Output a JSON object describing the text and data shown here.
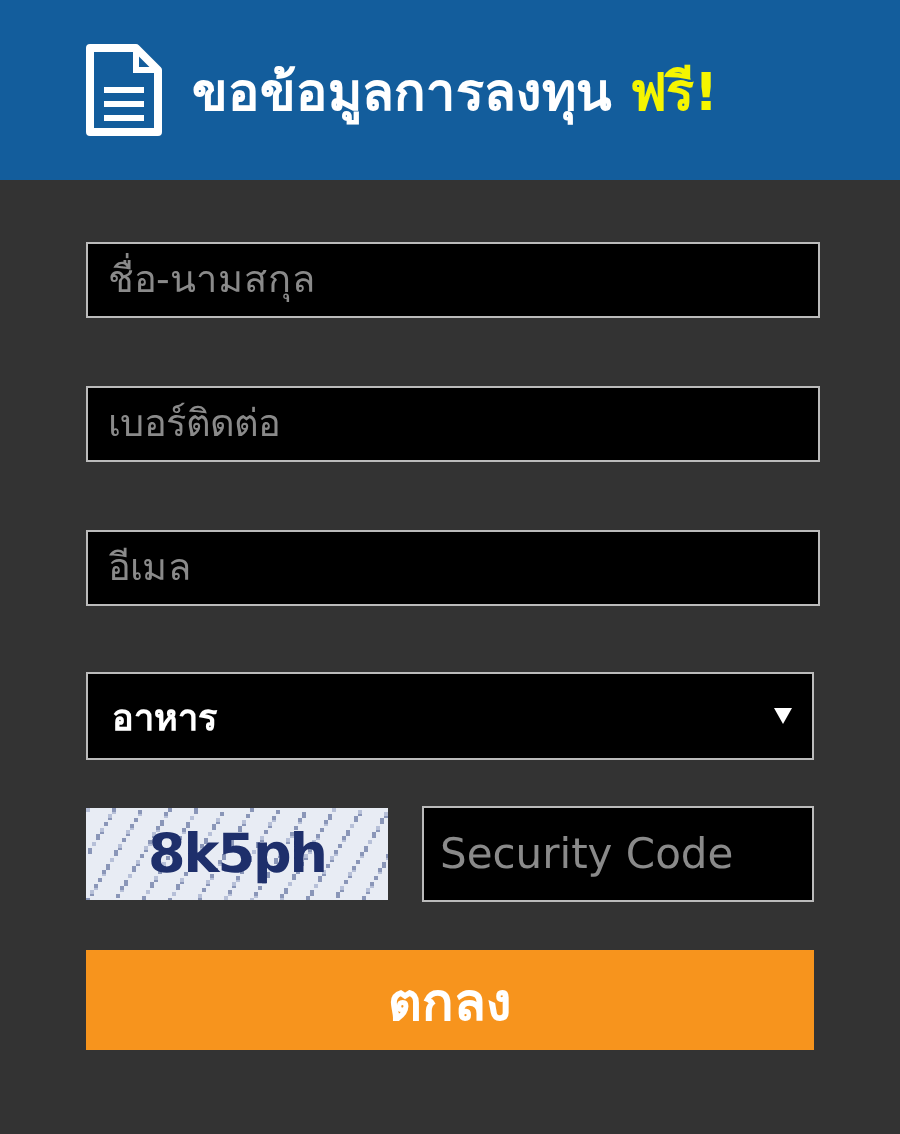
{
  "header": {
    "title": "ขอข้อมูลการลงทุน",
    "highlight": "ฟรี!"
  },
  "fields": [
    {
      "placeholder": "ชื่อ-นามสกุล"
    },
    {
      "placeholder": "เบอร์ติดต่อ"
    },
    {
      "placeholder": "อีเมล"
    }
  ],
  "category_select": {
    "value": "อาหาร"
  },
  "captcha": {
    "text": "8k5ph"
  },
  "security_field": {
    "placeholder": "Security Code"
  },
  "submit_button": {
    "label": "ตกลง"
  }
}
